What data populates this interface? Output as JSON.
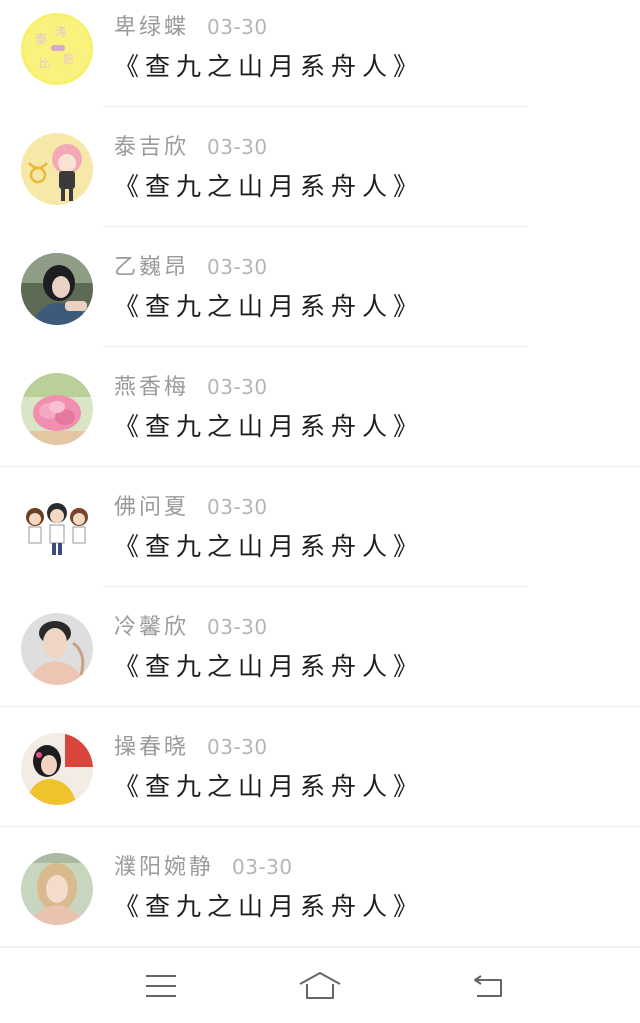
{
  "messages": [
    {
      "name": "卑绿蝶",
      "date": "03-30",
      "text": "《查九之山月系舟人》",
      "avatar": "yellow-circle-text-avatar"
    },
    {
      "name": "泰吉欣",
      "date": "03-30",
      "text": "《查九之山月系舟人》",
      "avatar": "anime-girl-taurus-avatar"
    },
    {
      "name": "乙巍昂",
      "date": "03-30",
      "text": "《查九之山月系舟人》",
      "avatar": "girl-photo-avatar"
    },
    {
      "name": "燕香梅",
      "date": "03-30",
      "text": "《查九之山月系舟人》",
      "avatar": "pink-flower-avatar"
    },
    {
      "name": "佛问夏",
      "date": "03-30",
      "text": "《查九之山月系舟人》",
      "avatar": "three-cartoon-boys-avatar"
    },
    {
      "name": "冷馨欣",
      "date": "03-30",
      "text": "《查九之山月系舟人》",
      "avatar": "man-portrait-avatar"
    },
    {
      "name": "操春晓",
      "date": "03-30",
      "text": "《查九之山月系舟人》",
      "avatar": "girl-yellow-shirt-avatar"
    },
    {
      "name": "濮阳婉静",
      "date": "03-30",
      "text": "《查九之山月系舟人》",
      "avatar": "blonde-girl-avatar"
    }
  ],
  "navbar": {
    "menu_icon": "menu-icon",
    "home_icon": "home-icon",
    "back_icon": "back-icon"
  },
  "colors": {
    "name": "#9a9a9a",
    "date": "#b5b5b5",
    "message": "#1e1e1e",
    "divider": "#eeeeee"
  }
}
